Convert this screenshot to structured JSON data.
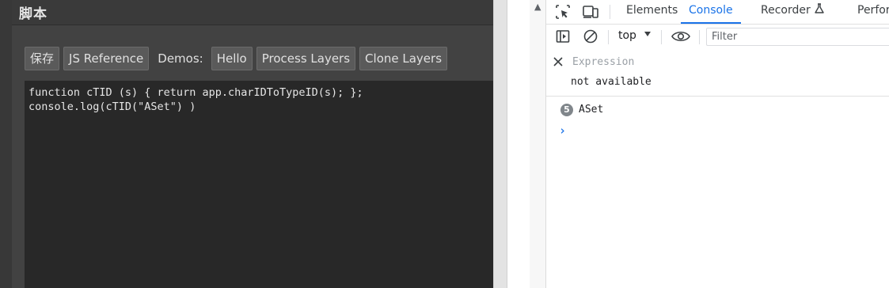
{
  "script_panel": {
    "title": "脚本",
    "save_label": "保存",
    "js_reference_label": "JS Reference",
    "demos_label": "Demos:",
    "demos": [
      "Hello",
      "Process Layers",
      "Clone Layers"
    ],
    "code": "function cTID (s) { return app.charIDToTypeID(s); };\nconsole.log(cTID(\"ASet\") )"
  },
  "devtools": {
    "tabs": [
      {
        "label": "Elements",
        "active": false
      },
      {
        "label": "Console",
        "active": true
      },
      {
        "label": "Recorder",
        "active": false
      },
      {
        "label": "Perfor",
        "active": false
      }
    ],
    "context": "top",
    "filter_placeholder": "Filter",
    "expression": {
      "placeholder": "Expression",
      "result": "not available"
    },
    "log": {
      "count": "5",
      "message": "ASet"
    },
    "prompt_symbol": "›"
  },
  "colors": {
    "accent": "#1a73e8",
    "panel_bg": "#424242",
    "editor_bg": "#282828",
    "button_bg": "#5a5a5a"
  },
  "icons": [
    "inspect-icon",
    "device-toolbar-icon",
    "flask-icon",
    "sidebar-toggle-icon",
    "clear-console-icon",
    "eye-icon",
    "close-icon"
  ]
}
